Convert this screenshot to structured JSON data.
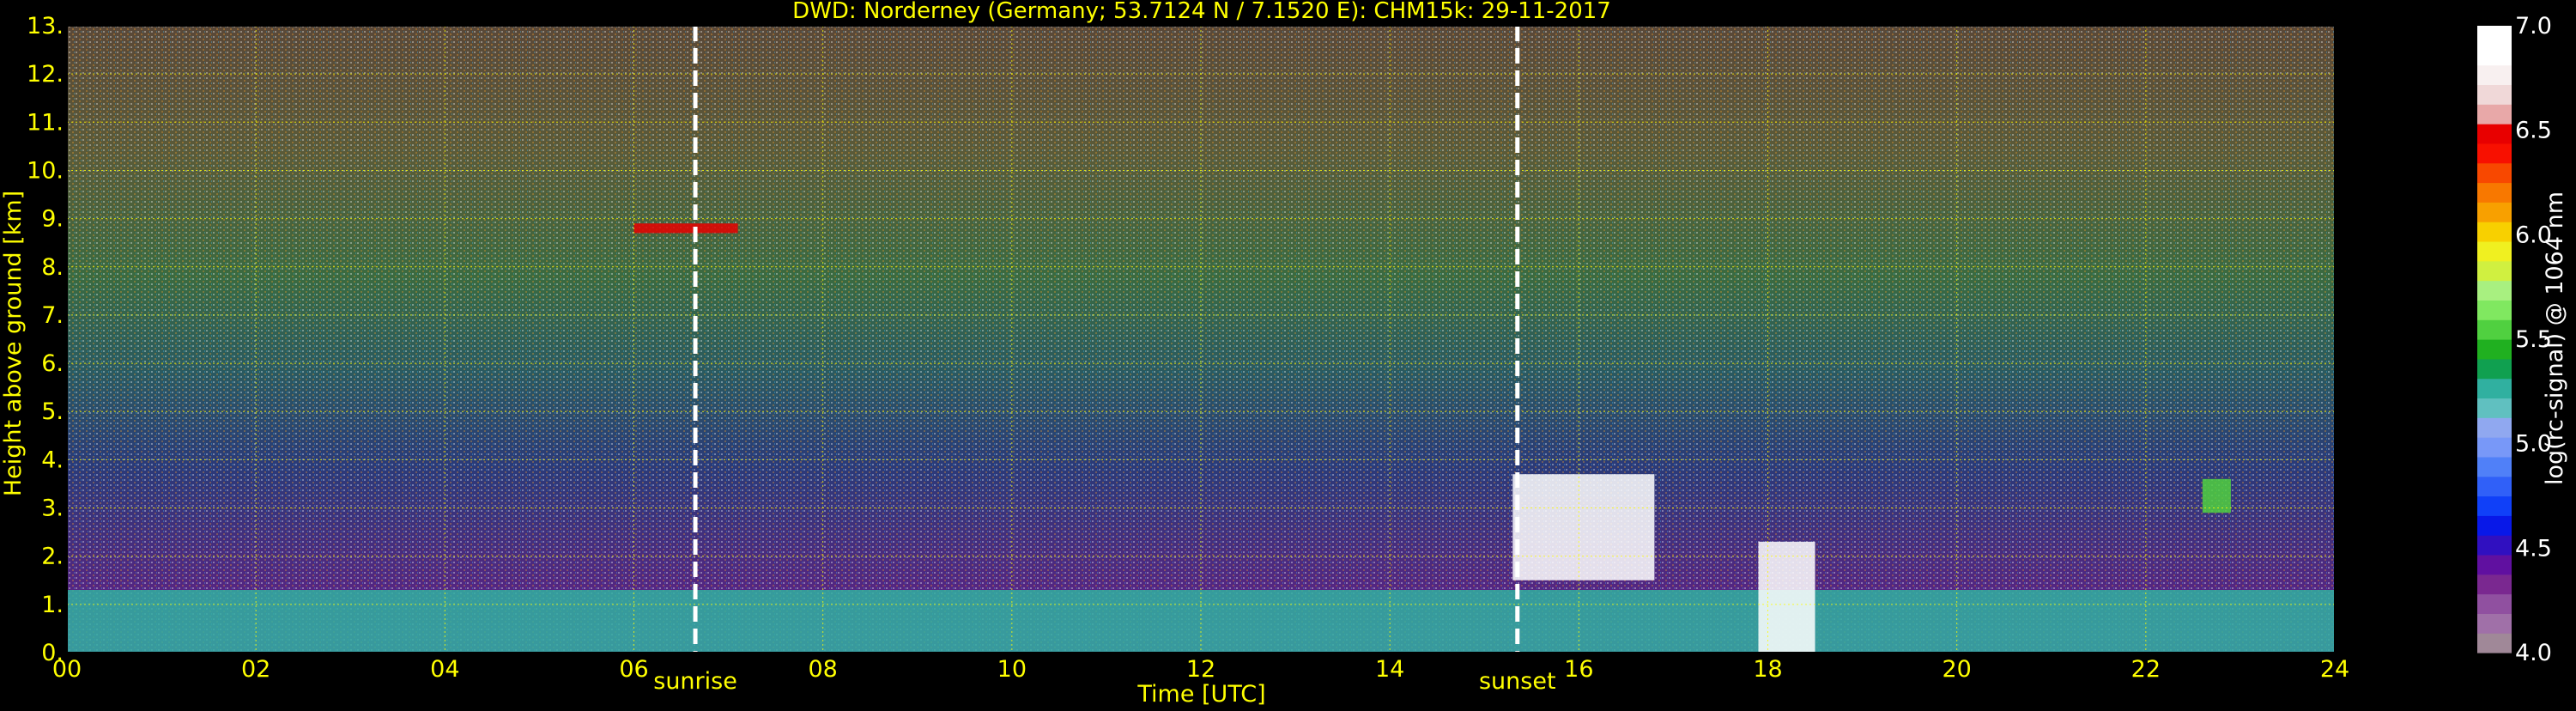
{
  "chart_data": {
    "type": "heatmap",
    "title": "DWD: Norderney (Germany; 53.7124 N / 7.1520 E):    CHM15k: 29-11-2017",
    "xlabel": "Time [UTC]",
    "ylabel": "Height above ground [km]",
    "xlim": [
      0,
      24
    ],
    "ylim": [
      0,
      13
    ],
    "x_ticks": [
      "00",
      "02",
      "04",
      "06",
      "08",
      "10",
      "12",
      "14",
      "16",
      "18",
      "20",
      "22",
      "24"
    ],
    "y_ticks": [
      "0.",
      "1.",
      "2.",
      "3.",
      "4.",
      "5.",
      "6.",
      "7.",
      "8.",
      "9.",
      "10.",
      "11.",
      "12.",
      "13."
    ],
    "grid": true,
    "grid_color": "#ffff00",
    "markers": [
      {
        "label": "sunrise",
        "x": 6.65
      },
      {
        "label": "sunset",
        "x": 15.35
      }
    ],
    "colorbar": {
      "label": "log(rc-signal) @ 1064 nm",
      "range": [
        4.0,
        7.0
      ],
      "ticks": [
        "4.0",
        "4.5",
        "5.0",
        "5.5",
        "6.0",
        "6.5",
        "7.0"
      ],
      "colors": [
        "#a08898",
        "#a070a8",
        "#9050a0",
        "#7a2890",
        "#6010a0",
        "#3010c0",
        "#0818e8",
        "#1040f8",
        "#3060f8",
        "#5080f8",
        "#7898f8",
        "#90a8f0",
        "#60c0c0",
        "#30b0a0",
        "#10a050",
        "#20b020",
        "#50d040",
        "#80e860",
        "#a8f080",
        "#d0f040",
        "#f0f020",
        "#f8d000",
        "#f8a000",
        "#f87800",
        "#f84800",
        "#f81000",
        "#e80000",
        "#e8a8a8",
        "#f0d8d8",
        "#f8f0f0",
        "#ffffff",
        "#ffffff"
      ]
    },
    "layers": [
      {
        "name": "boundary_layer_aerosol",
        "base_km": 0.0,
        "top_km": 1.3,
        "x": [
          0,
          24
        ],
        "log_signal": 5.3
      },
      {
        "name": "high_cloud",
        "base_km": 8.7,
        "top_km": 8.9,
        "x": [
          6.0,
          7.1
        ],
        "log_signal": 6.5
      },
      {
        "name": "cloud_after_sunset",
        "base_km": 1.5,
        "top_km": 3.7,
        "x": [
          15.3,
          16.8
        ],
        "log_signal": 7.0
      },
      {
        "name": "cloud_18utc",
        "base_km": 0.0,
        "top_km": 2.3,
        "x": [
          17.9,
          18.5
        ],
        "log_signal": 7.0
      },
      {
        "name": "small_cloud_22utc",
        "base_km": 2.9,
        "top_km": 3.6,
        "x": [
          22.6,
          22.9
        ],
        "log_signal": 5.5
      }
    ],
    "colors": {
      "axis_text": "#ffff00",
      "colorbar_text": "#ffffff",
      "background": "#000000"
    }
  }
}
